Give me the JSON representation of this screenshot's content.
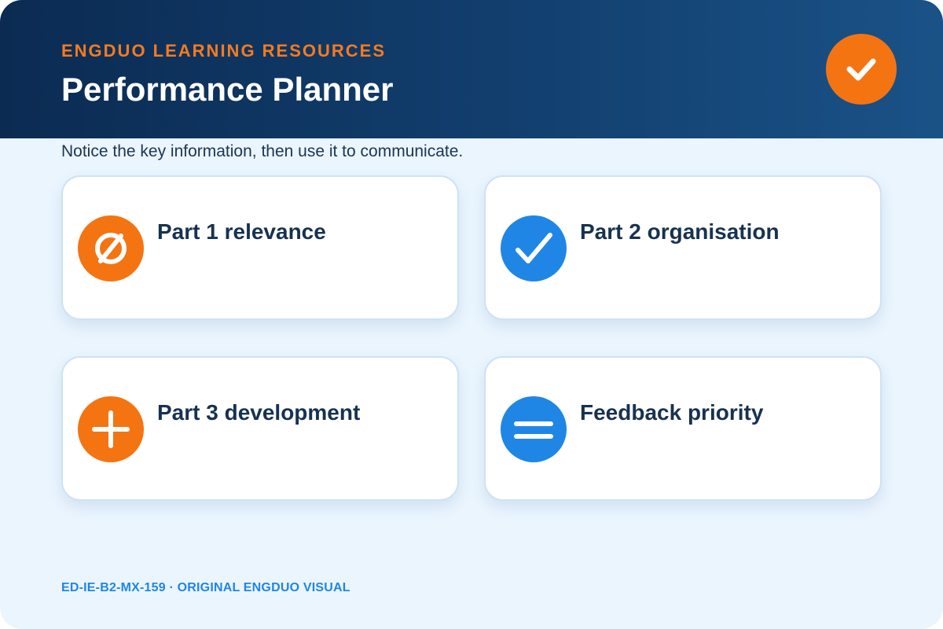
{
  "header": {
    "eyebrow": "ENGDUO LEARNING RESOURCES",
    "title": "Performance Planner",
    "badge_icon": "check-icon",
    "badge_color": "#f47412"
  },
  "subtitle": "Notice the key information, then use it to communicate.",
  "cards": [
    {
      "label": "Part 1 relevance",
      "icon": "empty-set-icon",
      "color": "#f47412"
    },
    {
      "label": "Part 2 organisation",
      "icon": "check-icon",
      "color": "#1f86e6"
    },
    {
      "label": "Part 3 development",
      "icon": "plus-icon",
      "color": "#f47412"
    },
    {
      "label": "Feedback priority",
      "icon": "equals-icon",
      "color": "#1f86e6"
    }
  ],
  "footer": "ED-IE-B2-MX-159 · ORIGINAL ENGDUO VISUAL",
  "colors": {
    "header_gradient": [
      "#0b2b52",
      "#1a5287"
    ],
    "accent_orange": "#f47412",
    "accent_blue": "#1f86e6",
    "background": "#eaf5fe"
  }
}
